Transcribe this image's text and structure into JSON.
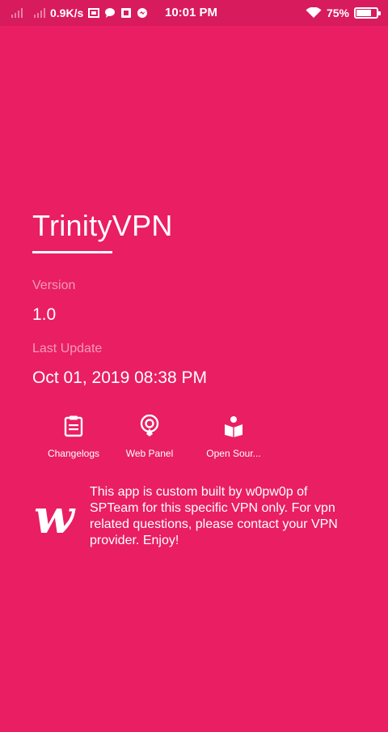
{
  "status_bar": {
    "speed": "0.9K/s",
    "time": "10:01 PM",
    "battery": "75%",
    "battery_level": 0.75,
    "icons": [
      "signal-icon",
      "signal-icon",
      "screenshot-icon",
      "chat-icon",
      "notification-icon",
      "messenger-icon",
      "wifi-icon",
      "battery-icon"
    ]
  },
  "app": {
    "title": "TrinityVPN"
  },
  "info": {
    "version_label": "Version",
    "version_value": "1.0",
    "last_update_label": "Last Update",
    "last_update_value": "Oct 01, 2019 08:38 PM"
  },
  "actions": [
    {
      "label": "Changelogs",
      "icon": "clipboard-icon"
    },
    {
      "label": "Web Panel",
      "icon": "web-panel-icon"
    },
    {
      "label": "Open Sour...",
      "icon": "book-icon"
    }
  ],
  "about": {
    "logo_letter": "w",
    "text": "This app is custom built by w0pw0p of SPTeam for this specific VPN only. For vpn related questions, please contact your VPN provider. Enjoy!"
  },
  "colors": {
    "background": "#E91E63",
    "status_bar": "#D81B5C",
    "text": "#FFFFFF"
  }
}
